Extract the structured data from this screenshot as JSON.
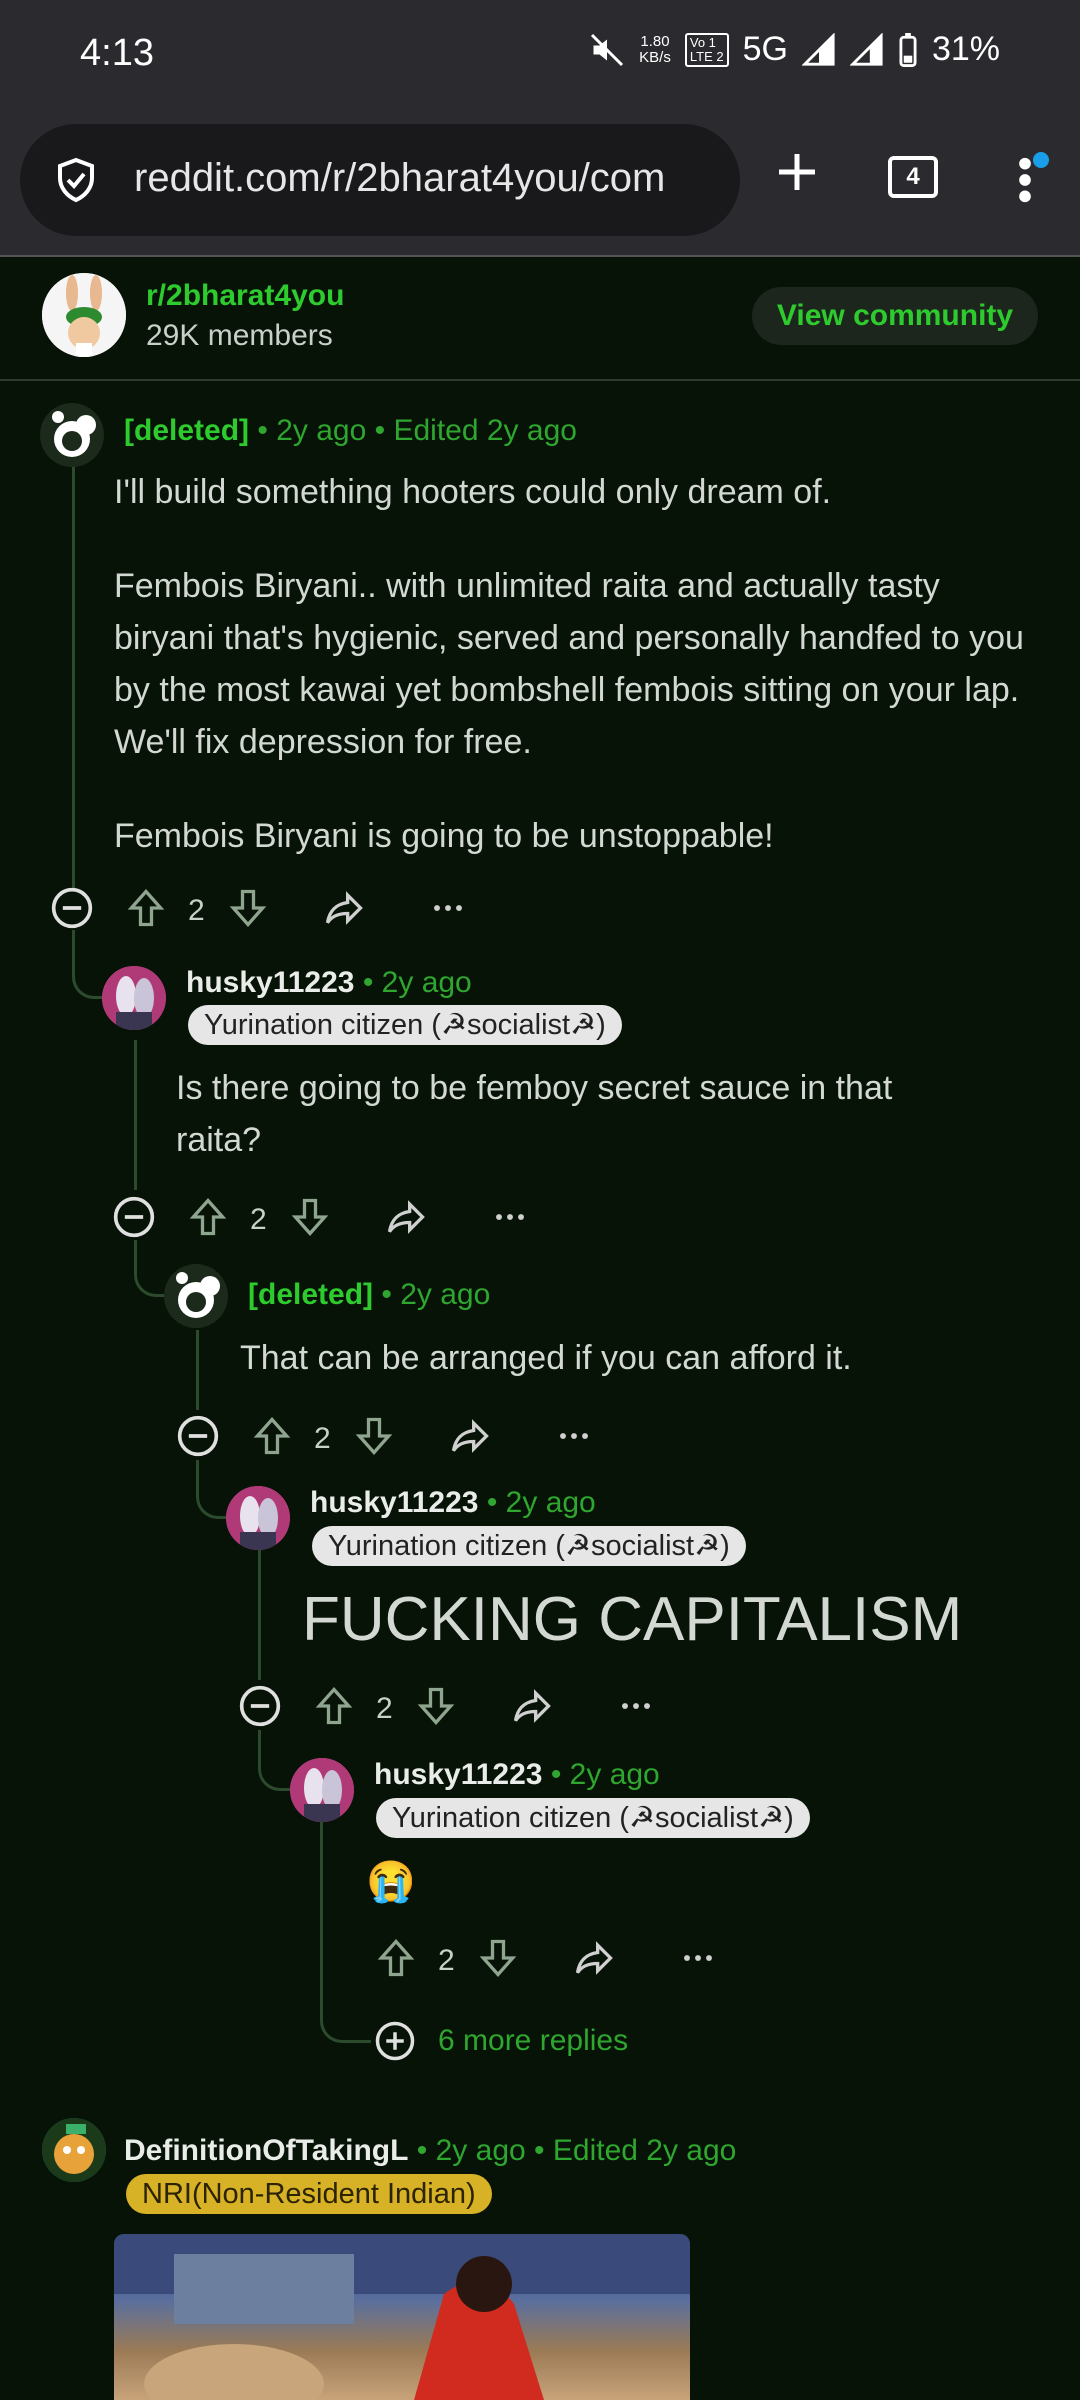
{
  "status_bar": {
    "time": "4:13",
    "speed_top": "1.80",
    "speed_bottom": "KB/s",
    "volte_top": "Vo 1",
    "volte_bottom": "LTE 2",
    "network": "5G",
    "battery": "31%"
  },
  "browser": {
    "url": "reddit.com/r/2bharat4you/com",
    "tab_count": "4"
  },
  "community": {
    "name": "r/2bharat4you",
    "members": "29K members",
    "view_button": "View community"
  },
  "comments": [
    {
      "author": "[deleted]",
      "time": "2y ago",
      "edited": "Edited 2y ago",
      "paragraphs": [
        "I'll build something hooters could only dream of.",
        "Fembois Biryani.. with unlimited raita and actually tasty biryani that's hygienic, served and personally handfed to you by the most kawai yet bombshell fembois sitting on your lap. We'll fix depression for free.",
        "Fembois Biryani is going to be unstoppable!"
      ],
      "score": "2"
    },
    {
      "author": "husky11223",
      "time": "2y ago",
      "flair": "Yurination citizen (☭socialist☭)",
      "text": "Is there going to be femboy secret sauce in that raita?",
      "score": "2"
    },
    {
      "author": "[deleted]",
      "time": "2y ago",
      "text": "That can be arranged if you can afford it.",
      "score": "2"
    },
    {
      "author": "husky11223",
      "time": "2y ago",
      "flair": "Yurination citizen (☭socialist☭)",
      "text": "FUCKING CAPITALISM",
      "score": "2"
    },
    {
      "author": "husky11223",
      "time": "2y ago",
      "flair": "Yurination citizen (☭socialist☭)",
      "text": "😭",
      "score": "2",
      "more_replies": "6 more replies"
    },
    {
      "author": "DefinitionOfTakingL",
      "time": "2y ago",
      "edited": "Edited 2y ago",
      "flair": "NRI(Non-Resident Indian)"
    }
  ],
  "colors": {
    "background": "#061306",
    "accent_green": "#2ecb2e",
    "meta_green": "#2fa62f",
    "bar": "#2b2a2e"
  }
}
